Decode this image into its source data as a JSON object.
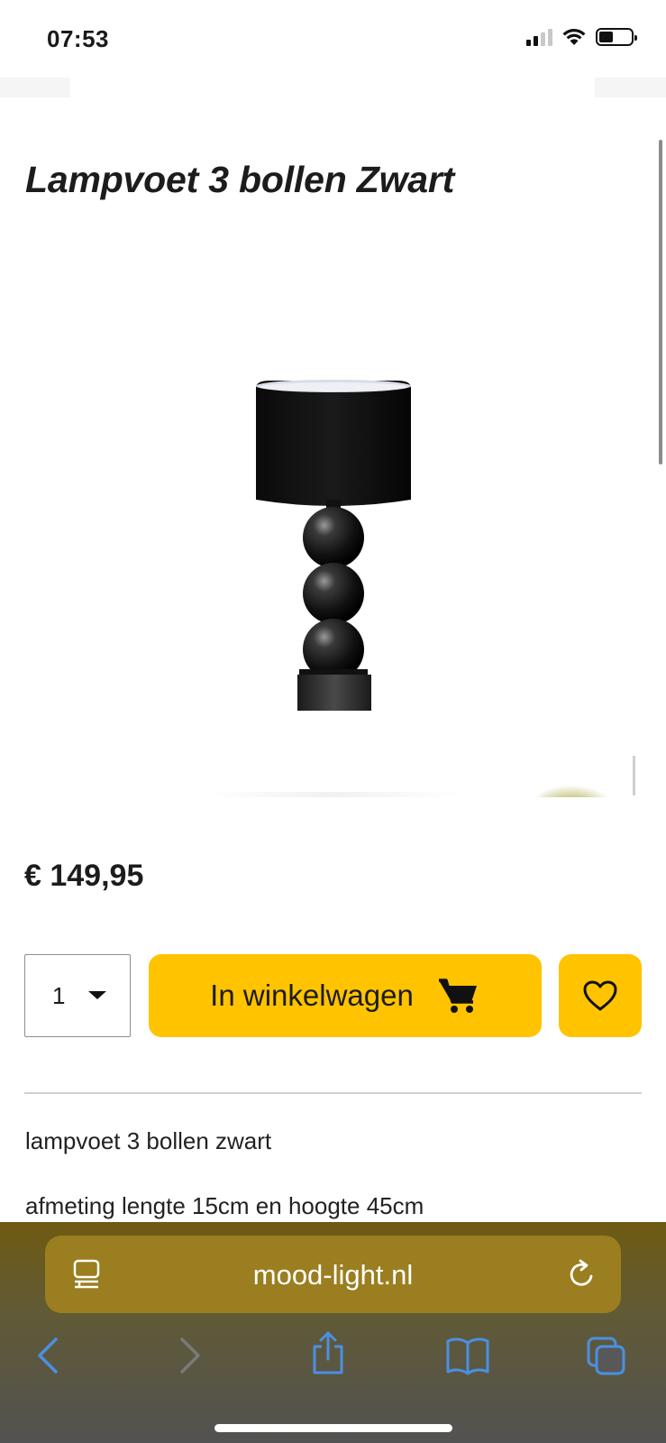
{
  "status_bar": {
    "time": "07:53"
  },
  "product": {
    "title": "Lampvoet 3 bollen Zwart",
    "image_icon": "lamp-image",
    "price": "€ 149,95",
    "quantity": "1",
    "add_to_cart_label": "In winkelwagen",
    "description": [
      "lampvoet 3 bollen zwart",
      "afmeting lengte 15cm en hoogte 45cm"
    ]
  },
  "browser": {
    "url": "mood-light.nl",
    "icons": [
      "reader-icon",
      "reload-icon",
      "back-icon",
      "forward-icon",
      "share-icon",
      "bookmarks-icon",
      "tabs-icon"
    ]
  },
  "colors": {
    "accent": "#ffc300",
    "text": "#1c1c1c",
    "browser_link": "#4a90e2"
  }
}
